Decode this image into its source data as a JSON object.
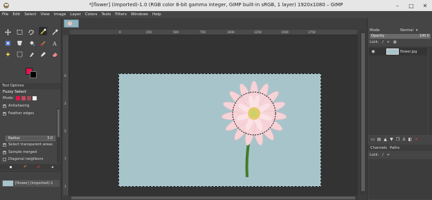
{
  "window": {
    "title": "*[flower] (imported)-1.0 (RGB color 8-bit gamma integer, GIMP built-in sRGB, 1 layer) 1920x1080 – GIMP",
    "minimize": "–",
    "maximize": "□",
    "close": "✕"
  },
  "menu": [
    "File",
    "Edit",
    "Select",
    "View",
    "Image",
    "Layer",
    "Colors",
    "Tools",
    "Filters",
    "Windows",
    "Help"
  ],
  "colors": {
    "foreground": "#e8124d",
    "background": "#000000",
    "canvas_bg": "#a8c4cb"
  },
  "tool_options": {
    "tab_label": "Tool Options",
    "tool_name": "Fuzzy Select",
    "mode_label": "Mode:",
    "antialiasing": "Antialiasing",
    "feather_edges": "Feather edges",
    "radius_label": "Radius",
    "radius_value": "3.0",
    "select_transparent": "Select transparent areas",
    "sample_merged": "Sample merged",
    "diagonal_neighbors": "Diagonal neighbors"
  },
  "images_panel": {
    "item_label": "[flower] (imported)-1"
  },
  "rulers": {
    "top": [
      "0",
      "250",
      "500",
      "750",
      "1000",
      "1250",
      "1500",
      "1750"
    ],
    "left": [
      "0",
      "2",
      "5",
      "7",
      "1"
    ]
  },
  "layers_panel": {
    "mode_label": "Mode",
    "mode_value": "Normal",
    "opacity_label": "Opacity",
    "opacity_value": "100.0",
    "lock_label": "Lock:",
    "layer_name": "flower.jpg"
  },
  "channels_panel": {
    "channels_tab": "Channels",
    "paths_tab": "Paths",
    "lock_label": "Lock:"
  }
}
